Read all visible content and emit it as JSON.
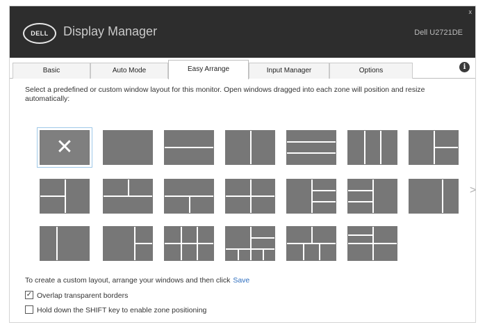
{
  "titlebar": {
    "logo_text": "DELL",
    "app_title": "Display Manager",
    "model": "Dell U2721DE",
    "close_glyph": "x"
  },
  "tabs": [
    {
      "label": "Basic",
      "active": false
    },
    {
      "label": "Auto Mode",
      "active": false
    },
    {
      "label": "Easy Arrange",
      "active": true
    },
    {
      "label": "Input Manager",
      "active": false
    },
    {
      "label": "Options",
      "active": false
    }
  ],
  "info_icon": {
    "glyph": "i",
    "icon": "info-icon"
  },
  "description": "Select a predefined or custom window layout for this monitor.  Open windows dragged into each zone will position and resize automatically:",
  "layouts": {
    "selected_index": 0,
    "selected_glyph": "✕",
    "count": 20,
    "next_arrow": ">"
  },
  "custom_layout": {
    "text": "To create a custom layout, arrange your windows and then click",
    "save_label": "Save"
  },
  "options": [
    {
      "label": "Overlap transparent borders",
      "checked": true
    },
    {
      "label": "Hold down the SHIFT key to enable zone positioning",
      "checked": false
    }
  ],
  "colors": {
    "titlebar": "#2d2d2d",
    "layout_tile": "#777777",
    "link": "#2f6fbf",
    "selected_outline": "#9ec8e8"
  }
}
